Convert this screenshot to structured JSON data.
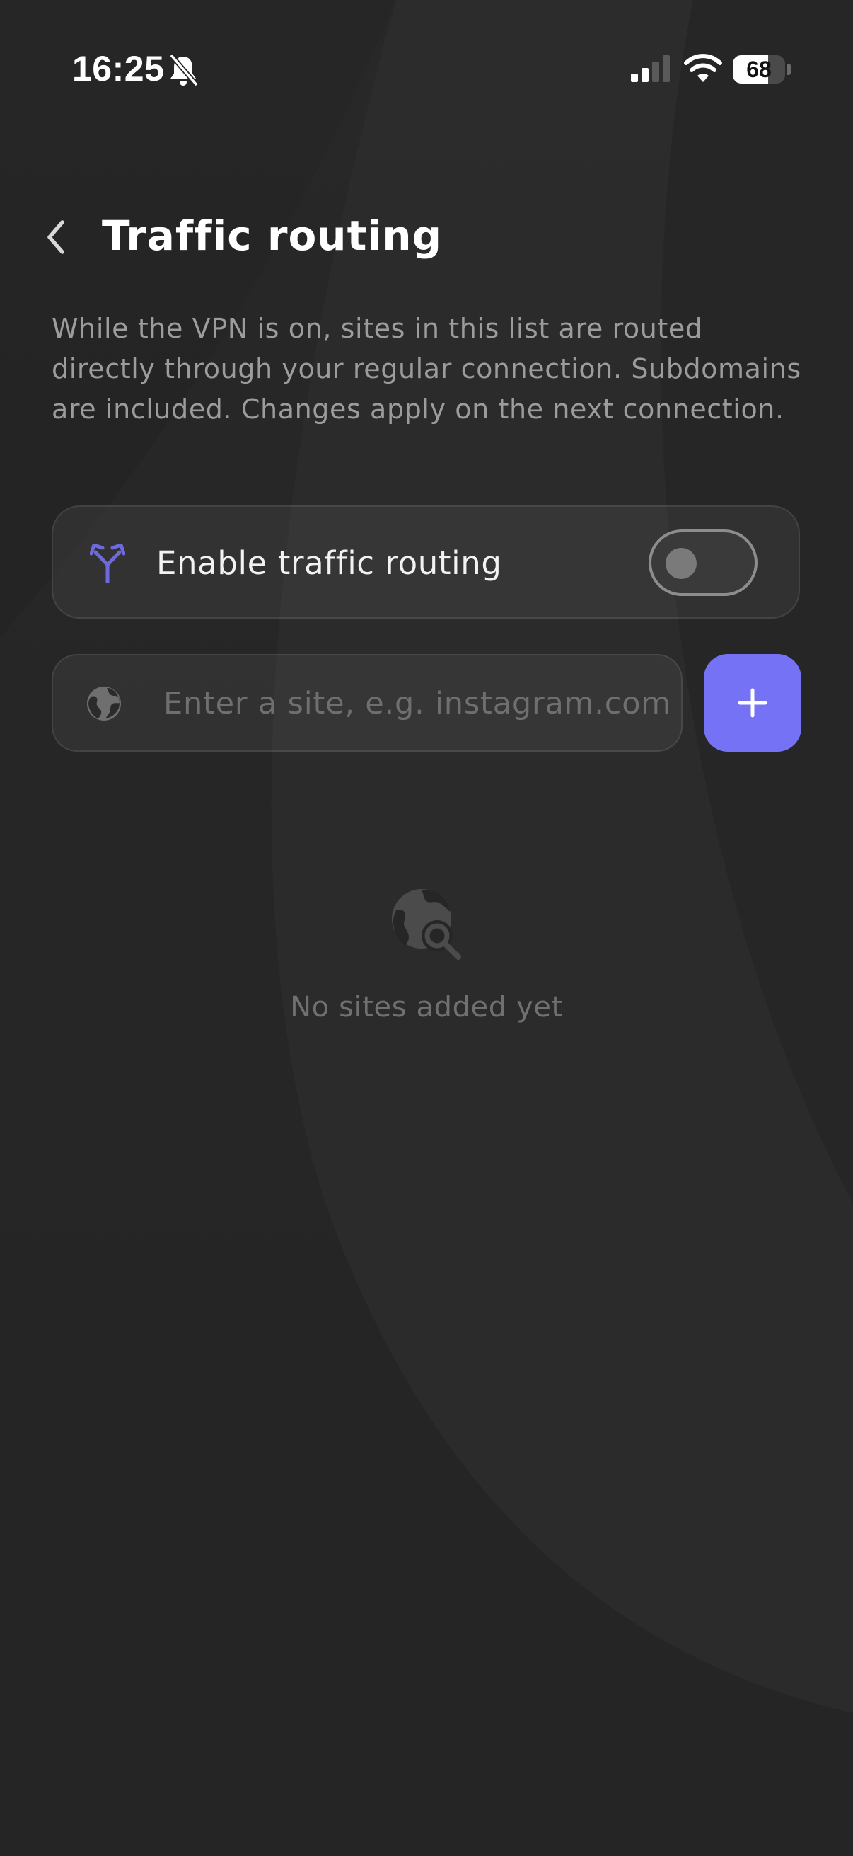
{
  "status_bar": {
    "time": "16:25",
    "battery_level": "68",
    "battery_fraction": 0.68,
    "icons": [
      "bell-slash-icon",
      "cellular-signal-icon",
      "wifi-icon",
      "battery-icon"
    ]
  },
  "header": {
    "back_icon": "chevron-left-icon",
    "title": "Traffic routing"
  },
  "description": "While the VPN is on, sites in this list are routed directly through your regular connection. Subdomains are included. Changes apply on the next connection.",
  "routing_toggle": {
    "icon": "fork-routing-icon",
    "label": "Enable traffic routing",
    "enabled": false
  },
  "site_input": {
    "icon": "globe-icon",
    "placeholder": "Enter a site, e.g. instagram.com",
    "value": ""
  },
  "add_button": {
    "icon": "plus-icon"
  },
  "empty_state": {
    "icon": "globe-search-icon",
    "text": "No sites added yet"
  },
  "colors": {
    "background": "#232323",
    "accent": "#7572f5",
    "routing_icon": "#6d6ae0",
    "text_primary": "#ffffff",
    "text_secondary": "#9c9c9c",
    "text_muted": "#707070"
  }
}
